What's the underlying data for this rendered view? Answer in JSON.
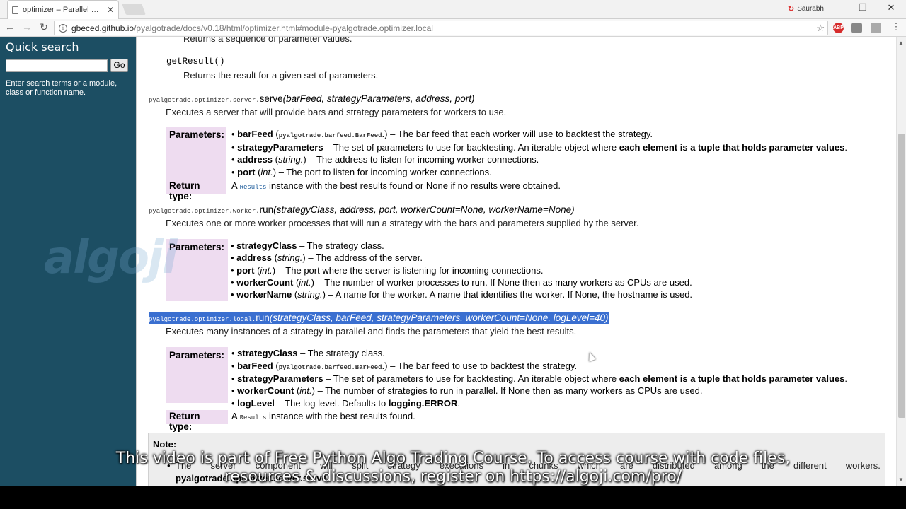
{
  "browser": {
    "tab_title": "optimizer – Parallel optimiz",
    "profile_name": "Saurabh",
    "url_host": "gbeced.github.io",
    "url_path": "/pyalgotrade/docs/v0.18/html/optimizer.html#module-pyalgotrade.optimizer.local",
    "icons": [
      "back-icon",
      "forward-icon",
      "reload-icon",
      "info-icon",
      "star-icon",
      "abp-icon",
      "menu-icon"
    ]
  },
  "sidebar": {
    "title": "Quick search",
    "go_label": "Go",
    "hint": "Enter search terms or a module, class or function name."
  },
  "doc": {
    "cut_line": "Returns a sequence of parameter values.",
    "getresult_sig": "getResult()",
    "getresult_desc": "Returns the result for a given set of parameters.",
    "serve_prefix": "pyalgotrade.optimizer.server.",
    "serve_name": "serve",
    "serve_args": "(barFeed, strategyParameters, address, port)",
    "serve_desc": "Executes a server that will provide bars and strategy parameters for workers to use.",
    "serve_params_label": "Parameters:",
    "serve_p1_name": "barFeed",
    "serve_p1_type": "pyalgotrade.barfeed.BarFeed",
    "serve_p1_desc": "– The bar feed that each worker will use to backtest the strategy.",
    "serve_p2_name": "strategyParameters",
    "serve_p2_desc": "– The set of parameters to use for backtesting. An iterable object where",
    "serve_p2_bold": "each element is a tuple that holds parameter values",
    "serve_p3_name": "address",
    "serve_p3_type": "string.",
    "serve_p3_desc": "– The address to listen for incoming worker connections.",
    "serve_p4_name": "port",
    "serve_p4_type": "int.",
    "serve_p4_desc": "– The port to listen for incoming worker connections.",
    "serve_rt_label": "Return type:",
    "serve_rt_a": "A",
    "serve_rt_code": "Results",
    "serve_rt_desc": "instance with the best results found or None if no results were obtained.",
    "worker_prefix": "pyalgotrade.optimizer.worker.",
    "worker_name": "run",
    "worker_args": "(strategyClass, address, port, workerCount=None, workerName=None)",
    "worker_desc": "Executes one or more worker processes that will run a strategy with the bars and parameters supplied by the server.",
    "worker_params_label": "Parameters:",
    "worker_p1_name": "strategyClass",
    "worker_p1_desc": "– The strategy class.",
    "worker_p2_name": "address",
    "worker_p2_type": "string.",
    "worker_p2_desc": "– The address of the server.",
    "worker_p3_name": "port",
    "worker_p3_type": "int.",
    "worker_p3_desc": "– The port where the server is listening for incoming connections.",
    "worker_p4_name": "workerCount",
    "worker_p4_type": "int.",
    "worker_p4_desc": "– The number of worker processes to run. If None then as many workers as CPUs are used.",
    "worker_p5_name": "workerName",
    "worker_p5_type": "string.",
    "worker_p5_desc": "– A name for the worker. A name that identifies the worker. If None, the hostname is used.",
    "local_prefix": "pyalgotrade.optimizer.local.",
    "local_name": "run",
    "local_args": "(strategyClass, barFeed, strategyParameters, workerCount=None, logLevel=40)",
    "local_desc": "Executes many instances of a strategy in parallel and finds the parameters that yield the best results.",
    "local_params_label": "Parameters:",
    "local_p1_name": "strategyClass",
    "local_p1_desc": "– The strategy class.",
    "local_p2_name": "barFeed",
    "local_p2_type": "pyalgotrade.barfeed.BarFeed",
    "local_p2_desc": "– The bar feed to use to backtest the strategy.",
    "local_p3_name": "strategyParameters",
    "local_p3_desc": "– The set of parameters to use for backtesting. An iterable object where",
    "local_p3_bold": "each element is a tuple that holds parameter values",
    "local_p4_name": "workerCount",
    "local_p4_type": "int.",
    "local_p4_desc": "– The number of strategies to run in parallel. If None then as many workers as CPUs are used.",
    "local_p5_name": "logLevel",
    "local_p5_desc": "– The log level. Defaults to",
    "local_p5_bold": "logging.ERROR",
    "local_rt_label": "Return type:",
    "local_rt_a": "A",
    "local_rt_code": "Results",
    "local_rt_desc": "instance with the best results found.",
    "note_title": "Note:",
    "note_words": [
      "The",
      "server",
      "component",
      "will",
      "split",
      "strategy",
      "executions",
      "in",
      "chunks",
      "which",
      "are",
      "distributed",
      "among",
      "the",
      "different",
      "workers."
    ],
    "note_line2": "pyalgotrade.optimizer.server.serve"
  },
  "watermark": "algoji",
  "caption": {
    "line1": "This video is part of Free Python Algo Trading Course. To access course with code files,",
    "line2": "resources & discussions, register on https://algoji.com/pro/"
  },
  "colors": {
    "sidebar": "#1c4e63",
    "param_label_bg": "#eedcf0",
    "highlight": "#3a6fd0",
    "note_bg": "#ededed"
  }
}
